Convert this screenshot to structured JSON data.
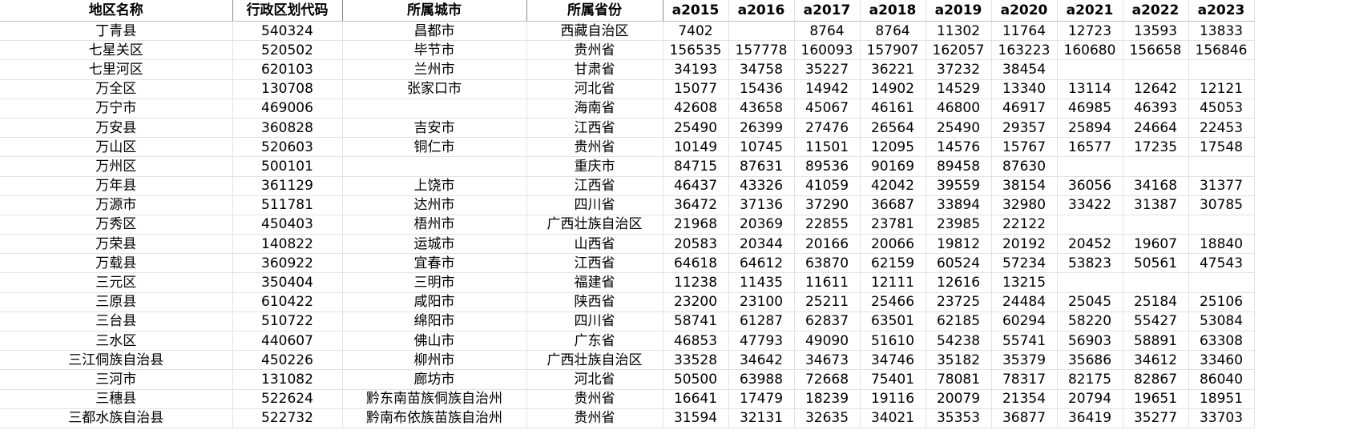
{
  "sheet": {
    "headers": [
      "地区名称",
      "行政区划代码",
      "所属城市",
      "所属省份",
      "a2015",
      "a2016",
      "a2017",
      "a2018",
      "a2019",
      "a2020",
      "a2021",
      "a2022",
      "a2023"
    ],
    "rows": [
      [
        "丁青县",
        "540324",
        "昌都市",
        "西藏自治区",
        "7402",
        "",
        "8764",
        "8764",
        "11302",
        "11764",
        "12723",
        "13593",
        "13833"
      ],
      [
        "七星关区",
        "520502",
        "毕节市",
        "贵州省",
        "156535",
        "157778",
        "160093",
        "157907",
        "162057",
        "163223",
        "160680",
        "156658",
        "156846"
      ],
      [
        "七里河区",
        "620103",
        "兰州市",
        "甘肃省",
        "34193",
        "34758",
        "35227",
        "36221",
        "37232",
        "38454",
        "",
        "",
        ""
      ],
      [
        "万全区",
        "130708",
        "张家口市",
        "河北省",
        "15077",
        "15436",
        "14942",
        "14902",
        "14529",
        "13340",
        "13114",
        "12642",
        "12121"
      ],
      [
        "万宁市",
        "469006",
        "",
        "海南省",
        "42608",
        "43658",
        "45067",
        "46161",
        "46800",
        "46917",
        "46985",
        "46393",
        "45053"
      ],
      [
        "万安县",
        "360828",
        "吉安市",
        "江西省",
        "25490",
        "26399",
        "27476",
        "26564",
        "25490",
        "29357",
        "25894",
        "24664",
        "22453"
      ],
      [
        "万山区",
        "520603",
        "铜仁市",
        "贵州省",
        "10149",
        "10745",
        "11501",
        "12095",
        "14576",
        "15767",
        "16577",
        "17235",
        "17548"
      ],
      [
        "万州区",
        "500101",
        "",
        "重庆市",
        "84715",
        "87631",
        "89536",
        "90169",
        "89458",
        "87630",
        "",
        "",
        ""
      ],
      [
        "万年县",
        "361129",
        "上饶市",
        "江西省",
        "46437",
        "43326",
        "41059",
        "42042",
        "39559",
        "38154",
        "36056",
        "34168",
        "31377"
      ],
      [
        "万源市",
        "511781",
        "达州市",
        "四川省",
        "36472",
        "37136",
        "37290",
        "36687",
        "33894",
        "32980",
        "33422",
        "31387",
        "30785"
      ],
      [
        "万秀区",
        "450403",
        "梧州市",
        "广西壮族自治区",
        "21968",
        "20369",
        "22855",
        "23781",
        "23985",
        "22122",
        "",
        "",
        ""
      ],
      [
        "万荣县",
        "140822",
        "运城市",
        "山西省",
        "20583",
        "20344",
        "20166",
        "20066",
        "19812",
        "20192",
        "20452",
        "19607",
        "18840"
      ],
      [
        "万载县",
        "360922",
        "宜春市",
        "江西省",
        "64618",
        "64612",
        "63870",
        "62159",
        "60524",
        "57234",
        "53823",
        "50561",
        "47543"
      ],
      [
        "三元区",
        "350404",
        "三明市",
        "福建省",
        "11238",
        "11435",
        "11611",
        "12111",
        "12616",
        "13215",
        "",
        "",
        ""
      ],
      [
        "三原县",
        "610422",
        "咸阳市",
        "陕西省",
        "23200",
        "23100",
        "25211",
        "25466",
        "23725",
        "24484",
        "25045",
        "25184",
        "25106"
      ],
      [
        "三台县",
        "510722",
        "绵阳市",
        "四川省",
        "58741",
        "61287",
        "62837",
        "63501",
        "62185",
        "60294",
        "58220",
        "55427",
        "53084"
      ],
      [
        "三水区",
        "440607",
        "佛山市",
        "广东省",
        "46853",
        "47793",
        "49090",
        "51610",
        "54238",
        "55741",
        "56903",
        "58891",
        "63308"
      ],
      [
        "三江侗族自治县",
        "450226",
        "柳州市",
        "广西壮族自治区",
        "33528",
        "34642",
        "34673",
        "34746",
        "35182",
        "35379",
        "35686",
        "34612",
        "33460"
      ],
      [
        "三河市",
        "131082",
        "廊坊市",
        "河北省",
        "50500",
        "63988",
        "72668",
        "75401",
        "78081",
        "78317",
        "82175",
        "82867",
        "86040"
      ],
      [
        "三穗县",
        "522624",
        "黔东南苗族侗族自治州",
        "贵州省",
        "16641",
        "17479",
        "18239",
        "19116",
        "20079",
        "21354",
        "20794",
        "19651",
        "18951"
      ],
      [
        "三都水族自治县",
        "522732",
        "黔南布依族苗族自治州",
        "贵州省",
        "31594",
        "32131",
        "32635",
        "34021",
        "35353",
        "36877",
        "36419",
        "35277",
        "33703"
      ]
    ]
  }
}
